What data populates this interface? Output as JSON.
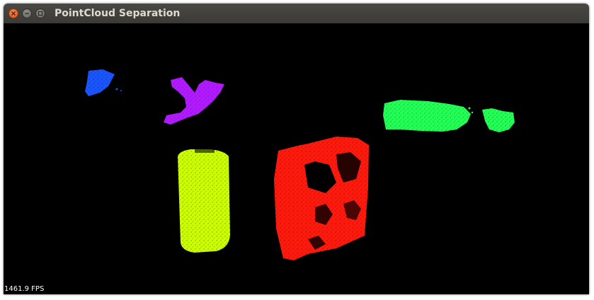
{
  "window": {
    "title": "PointCloud Separation",
    "controls": [
      "close-icon",
      "minimize-icon",
      "maximize-icon"
    ]
  },
  "viewport": {
    "background": "#000000",
    "fps_label": "1461.9 FPS",
    "clusters": [
      {
        "name": "cluster-blue",
        "color": "#1a55ff"
      },
      {
        "name": "cluster-purple",
        "color": "#b21aff"
      },
      {
        "name": "cluster-green",
        "color": "#22ff55"
      },
      {
        "name": "cluster-yellow",
        "color": "#ccff00"
      },
      {
        "name": "cluster-red",
        "color": "#ff1a0d"
      }
    ]
  }
}
